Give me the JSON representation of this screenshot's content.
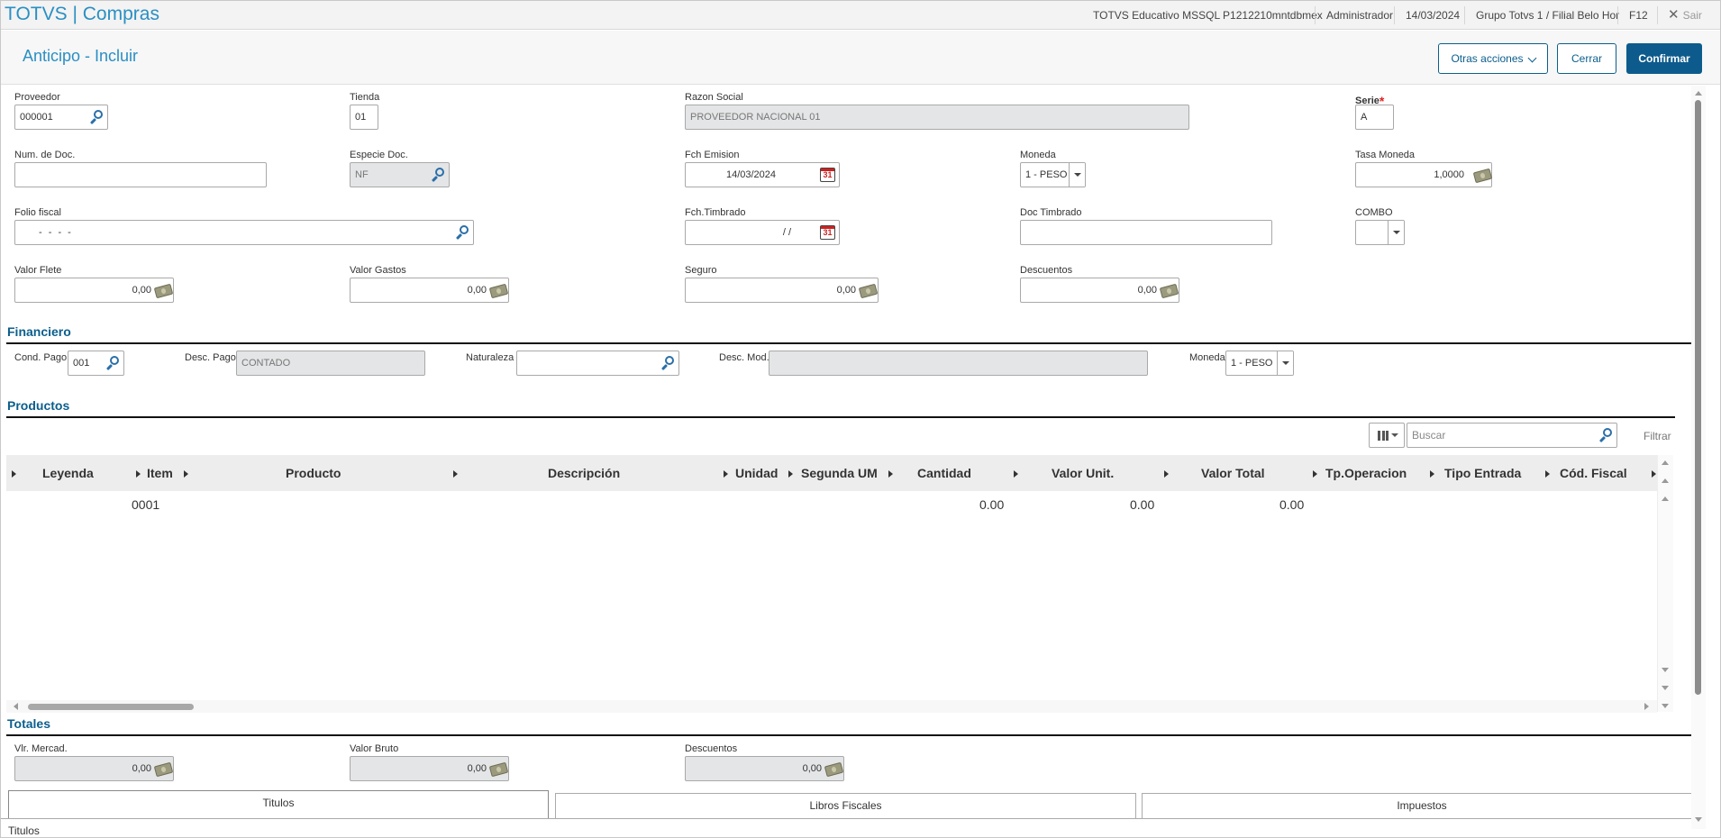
{
  "app": {
    "title": "TOTVS | Compras"
  },
  "topbar": {
    "environment": "TOTVS Educativo MSSQL P1212210mntdbmex",
    "user": "Administrador",
    "date": "14/03/2024",
    "branch": "Grupo Totvs 1 / Filial Belo Hor",
    "shortcut": "F12",
    "exit": "Sair"
  },
  "header": {
    "title": "Anticipo - Incluir",
    "other_actions": "Otras acciones",
    "close": "Cerrar",
    "confirm": "Confirmar"
  },
  "form": {
    "proveedor": {
      "label": "Proveedor",
      "value": "000001"
    },
    "tienda": {
      "label": "Tienda",
      "value": "01"
    },
    "razon_social": {
      "label": "Razon Social",
      "value": "PROVEEDOR NACIONAL 01"
    },
    "serie": {
      "label": "Serie",
      "required": "*",
      "value": "A"
    },
    "num_doc": {
      "label": "Num. de Doc.",
      "value": ""
    },
    "especie_doc": {
      "label": "Especie Doc.",
      "value": "NF"
    },
    "fch_emision": {
      "label": "Fch Emision",
      "value": "14/03/2024"
    },
    "moneda": {
      "label": "Moneda",
      "value": "1 - PESO"
    },
    "tasa_moneda": {
      "label": "Tasa Moneda",
      "value": "1,0000"
    },
    "folio_fiscal": {
      "label": "Folio fiscal",
      "value": "-  -  -  -"
    },
    "fch_timbrado": {
      "label": "Fch.Timbrado",
      "value": "/  /"
    },
    "doc_timbrado": {
      "label": "Doc Timbrado",
      "value": ""
    },
    "combo": {
      "label": "COMBO",
      "value": ""
    },
    "valor_flete": {
      "label": "Valor Flete",
      "value": "0,00"
    },
    "valor_gastos": {
      "label": "Valor Gastos",
      "value": "0,00"
    },
    "seguro": {
      "label": "Seguro",
      "value": "0,00"
    },
    "descuentos": {
      "label": "Descuentos",
      "value": "0,00"
    }
  },
  "financiero": {
    "title": "Financiero",
    "cond_pago": {
      "label": "Cond. Pago",
      "value": "001"
    },
    "desc_pago": {
      "label": "Desc. Pago",
      "value": "CONTADO"
    },
    "naturaleza": {
      "label": "Naturaleza",
      "value": ""
    },
    "desc_mod": {
      "label": "Desc. Mod.",
      "value": ""
    },
    "moneda": {
      "label": "Moneda",
      "value": "1 - PESO"
    }
  },
  "productos": {
    "title": "Productos",
    "search_placeholder": "Buscar",
    "filter": "Filtrar",
    "columns": [
      "Leyenda",
      "Item",
      "Producto",
      "Descripción",
      "Unidad",
      "Segunda UM",
      "Cantidad",
      "Valor Unit.",
      "Valor Total",
      "Tp.Operacion",
      "Tipo Entrada",
      "Cód. Fiscal"
    ],
    "rows": [
      {
        "item": "0001",
        "cantidad": "0.00",
        "valor_unit": "0.00",
        "valor_total": "0.00"
      }
    ]
  },
  "totales": {
    "title": "Totales",
    "vlr_mercad": {
      "label": "Vlr. Mercad.",
      "value": "0,00"
    },
    "valor_bruto": {
      "label": "Valor Bruto",
      "value": "0,00"
    },
    "descuentos": {
      "label": "Descuentos",
      "value": "0,00"
    }
  },
  "tabs": [
    "Titulos",
    "Libros Fiscales",
    "Impuestos"
  ],
  "tab_content_title": "Titulos",
  "colors": {
    "accent": "#2a8fc3",
    "primary": "#0d5b8c",
    "readonly": "#e4e5e6"
  }
}
